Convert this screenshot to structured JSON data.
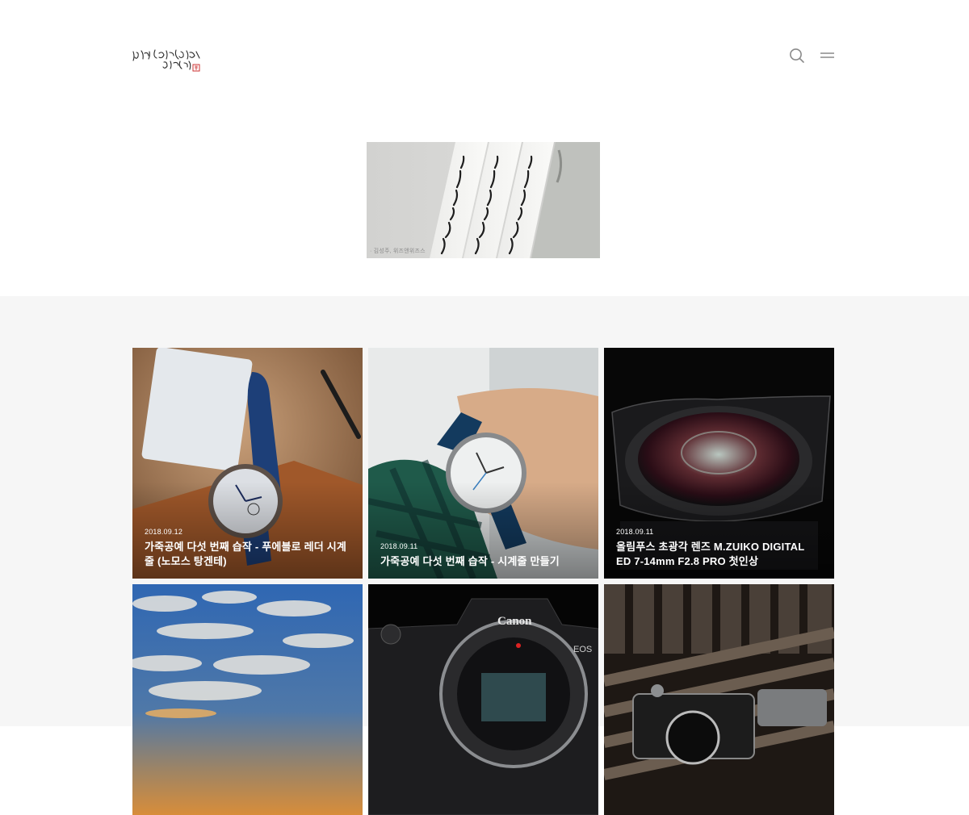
{
  "header": {
    "logo_text": "이야기 하는 사진들 김석주",
    "search_icon": "search-icon",
    "menu_icon": "menu-icon"
  },
  "hero": {
    "credit": "· 김성주, 위즈앤위즈스"
  },
  "posts": [
    {
      "date": "2018.09.12",
      "title": "가죽공예 다섯 번째 습작 - 푸에블로 레더 시계줄 (노모스 탕겐테)"
    },
    {
      "date": "2018.09.11",
      "title": "가죽공예 다섯 번째 습작 - 시계줄 만들기"
    },
    {
      "date": "2018.09.11",
      "title": "올림푸스 초광각 렌즈 M.ZUIKO DIGITAL ED 7-14mm F2.8 PRO 첫인상"
    },
    {
      "date": "",
      "title": ""
    },
    {
      "date": "",
      "title": ""
    },
    {
      "date": "",
      "title": ""
    }
  ],
  "colors": {
    "page_bg": "#ffffff",
    "section_bg": "#f6f6f6",
    "icon": "#8a8a8a"
  }
}
